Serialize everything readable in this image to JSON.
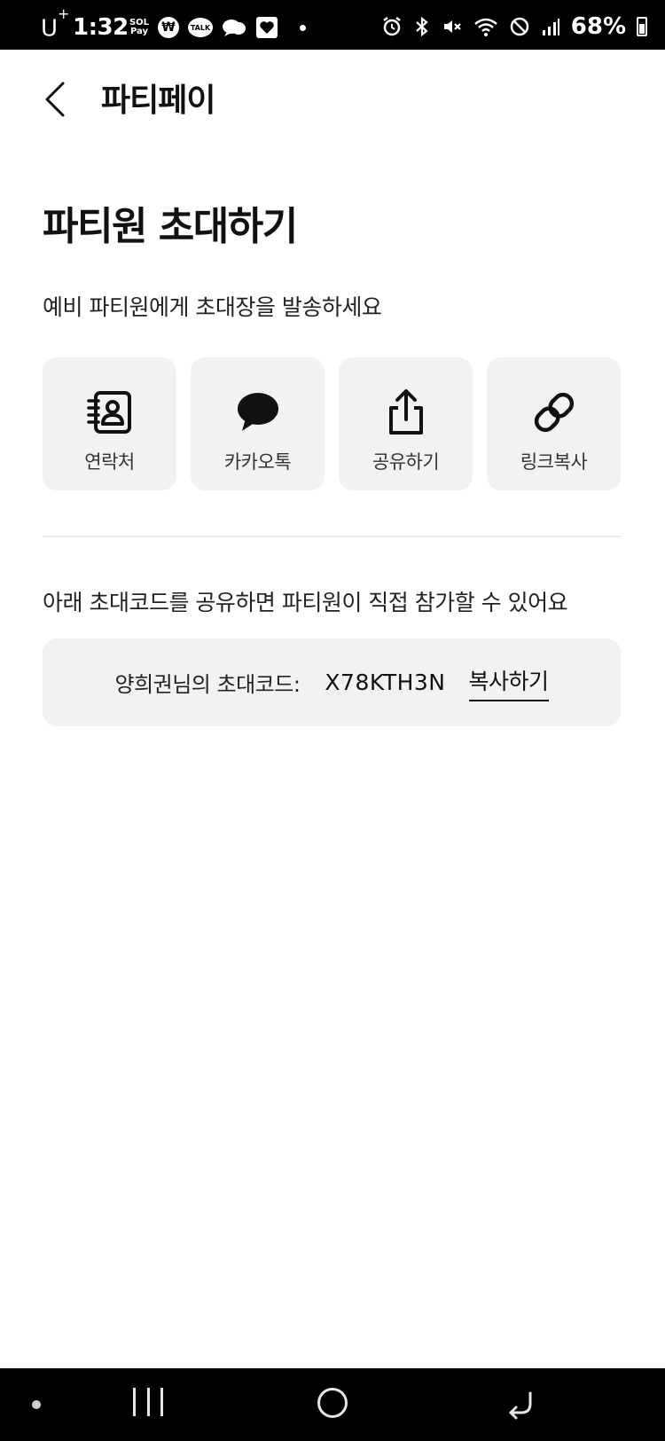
{
  "status_bar": {
    "carrier": "U",
    "carrier_sup": "+",
    "time": "1:32",
    "pay_label_top": "SOL",
    "pay_label_bottom": "Pay",
    "won_symbol": "₩",
    "talk_label": "TALK",
    "battery": "68%"
  },
  "header": {
    "title": "파티페이"
  },
  "main": {
    "title": "파티원 초대하기",
    "subtitle": "예비 파티원에게 초대장을 발송하세요",
    "share_options": [
      {
        "label": "연락처",
        "icon": "contacts-icon"
      },
      {
        "label": "카카오톡",
        "icon": "kakaotalk-icon"
      },
      {
        "label": "공유하기",
        "icon": "share-icon"
      },
      {
        "label": "링크복사",
        "icon": "link-icon"
      }
    ],
    "code_description": "아래 초대코드를 공유하면 파티원이 직접 참가할 수 있어요",
    "code_label": "양희권님의 초대코드:",
    "code_value": "X78KTH3N",
    "copy_label": "복사하기"
  },
  "colors": {
    "tile_background": "#f2f2f4",
    "text_primary": "#111111",
    "system_bar": "#000000"
  }
}
